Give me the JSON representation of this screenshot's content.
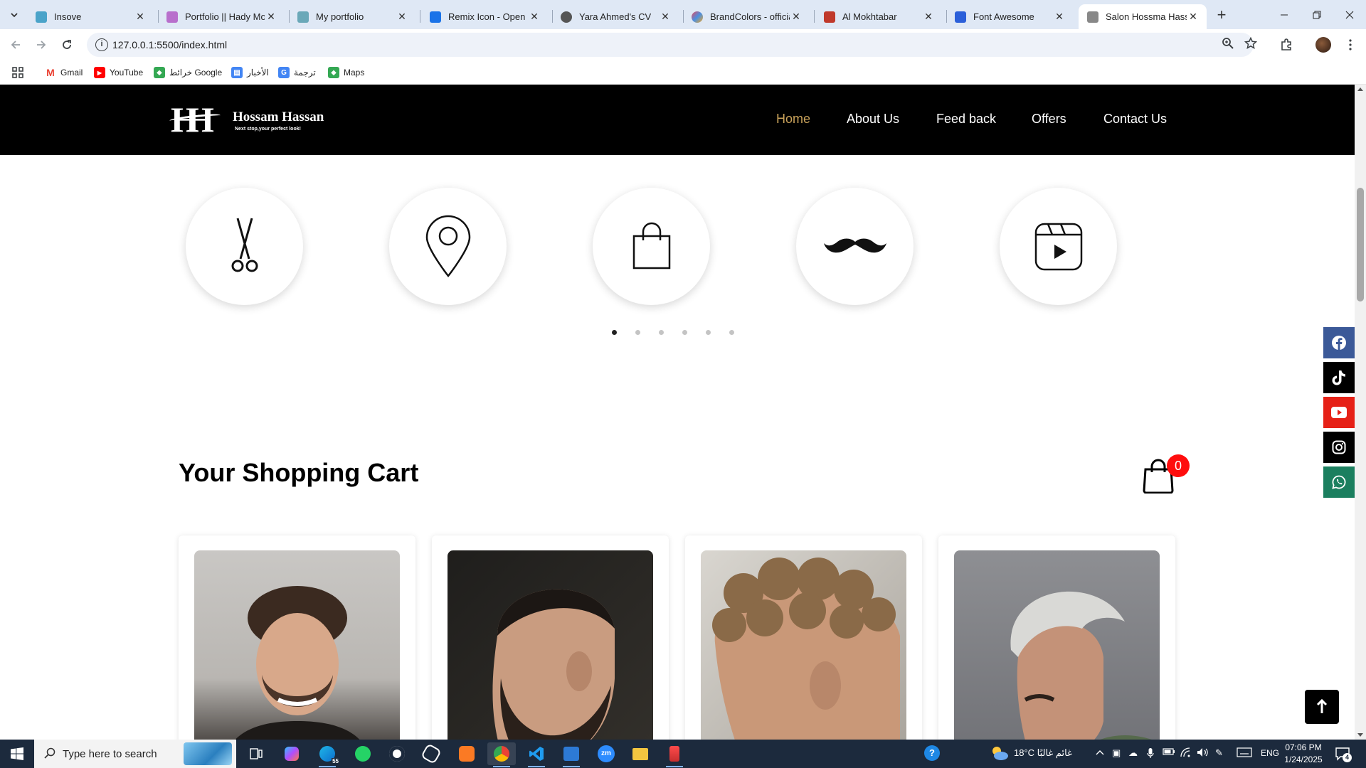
{
  "browser": {
    "tabs": [
      {
        "title": "Insove",
        "favicon_color": "#4aa3c9",
        "active": false
      },
      {
        "title": "Portfolio || Hady Moh",
        "favicon_color": "#b86fcc",
        "active": false
      },
      {
        "title": "My portfolio",
        "favicon_color": "#6aa8b8",
        "active": false
      },
      {
        "title": "Remix Icon - Open so",
        "favicon_color": "#1a73e8",
        "active": false
      },
      {
        "title": "Yara Ahmed's CV",
        "favicon_color": "#555555",
        "active": false
      },
      {
        "title": "BrandColors - official",
        "favicon_color": "#e84a5f",
        "active": false
      },
      {
        "title": "Al Mokhtabar",
        "favicon_color": "#c0392b",
        "active": false
      },
      {
        "title": "Font Awesome",
        "favicon_color": "#2b5fd9",
        "active": false
      },
      {
        "title": "Salon Hossma Hassan",
        "favicon_color": "#888888",
        "active": true
      }
    ],
    "url": "127.0.0.1:5500/index.html",
    "bookmarks": [
      {
        "label": "Gmail",
        "icon": "gmail-icon",
        "color": "#ea4335"
      },
      {
        "label": "YouTube",
        "icon": "youtube-icon",
        "color": "#ff0000"
      },
      {
        "label": "خرائط Google",
        "icon": "google-maps-icon",
        "color": "#34a853"
      },
      {
        "label": "الأخبار",
        "icon": "google-news-icon",
        "color": "#4285f4"
      },
      {
        "label": "ترجمة",
        "icon": "google-translate-icon",
        "color": "#4285f4"
      },
      {
        "label": "Maps",
        "icon": "maps-icon",
        "color": "#34a853"
      }
    ]
  },
  "site": {
    "logo": {
      "mark": "H",
      "name": "Hossam Hassan",
      "slogan": "Next stop,your perfect look!"
    },
    "nav": [
      {
        "label": "Home",
        "active": true
      },
      {
        "label": "About Us",
        "active": false
      },
      {
        "label": "Feed back",
        "active": false
      },
      {
        "label": "Offers",
        "active": false
      },
      {
        "label": "Contact Us",
        "active": false
      }
    ],
    "accent_color": "#c9a25a",
    "service_icons": [
      "scissors-icon",
      "location-pin-icon",
      "shopping-bag-icon",
      "mustache-icon",
      "video-play-icon"
    ],
    "carousel": {
      "pages": 6,
      "active_index": 0
    },
    "cart": {
      "title": "Your Shopping Cart",
      "count": "0",
      "badge_color": "#ff0d0d"
    },
    "products": [
      {
        "photo": "man-smiling-beard-photo"
      },
      {
        "photo": "man-beard-fade-photo"
      },
      {
        "photo": "curly-hair-fade-photo"
      },
      {
        "photo": "grey-hair-quiff-photo"
      }
    ],
    "social": [
      {
        "icon": "facebook-icon",
        "color": "#3b5998"
      },
      {
        "icon": "tiktok-icon",
        "color": "#000000"
      },
      {
        "icon": "youtube-icon",
        "color": "#e62117"
      },
      {
        "icon": "instagram-icon",
        "color": "#000000"
      },
      {
        "icon": "whatsapp-icon",
        "color": "#1b7f5f"
      }
    ]
  },
  "taskbar": {
    "search_placeholder": "Type here to search",
    "edge_badge": "55",
    "weather": "18°C  غائم غالبًا",
    "language": "ENG",
    "time": "07:06 PM",
    "date": "1/24/2025",
    "notifications": "4"
  }
}
